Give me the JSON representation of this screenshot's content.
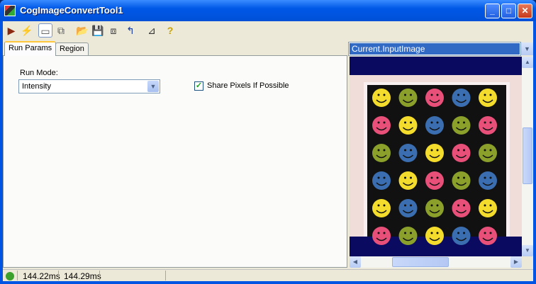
{
  "window": {
    "title": "CogImageConvertTool1",
    "controls": [
      "minimize",
      "maximize",
      "close"
    ]
  },
  "toolbar": {
    "icons": [
      "run-icon",
      "electric-icon",
      "local-graphics-icon",
      "floating-graphics-icon",
      "open-icon",
      "save-icon",
      "save-settings-icon",
      "reset-icon",
      "show-results-icon",
      "help-icon"
    ]
  },
  "tabs": [
    {
      "label": "Run Params",
      "selected": true
    },
    {
      "label": "Region",
      "selected": false
    }
  ],
  "run_params": {
    "run_mode_label": "Run Mode:",
    "run_mode_value": "Intensity",
    "share_pixels_label": "Share Pixels If Possible",
    "share_pixels_checked": true
  },
  "image_view": {
    "selected_image": "Current.InputImage",
    "smiley_colors": [
      [
        "#f4dc2c",
        "#8aa02a",
        "#e8507a",
        "#3a6eb0",
        "#f4dc2c"
      ],
      [
        "#e8507a",
        "#f4dc2c",
        "#3a6eb0",
        "#8aa02a",
        "#e8507a"
      ],
      [
        "#8aa02a",
        "#3a6eb0",
        "#f4dc2c",
        "#e8507a",
        "#8aa02a"
      ],
      [
        "#3a6eb0",
        "#f4dc2c",
        "#e8507a",
        "#8aa02a",
        "#3a6eb0"
      ],
      [
        "#f4dc2c",
        "#3a6eb0",
        "#8aa02a",
        "#e8507a",
        "#f4dc2c"
      ],
      [
        "#e8507a",
        "#8aa02a",
        "#f4dc2c",
        "#3a6eb0",
        "#e8507a"
      ]
    ]
  },
  "status": {
    "indicator_color": "#3ca02c",
    "time1": "144.22ms",
    "time2": "144.29ms"
  }
}
